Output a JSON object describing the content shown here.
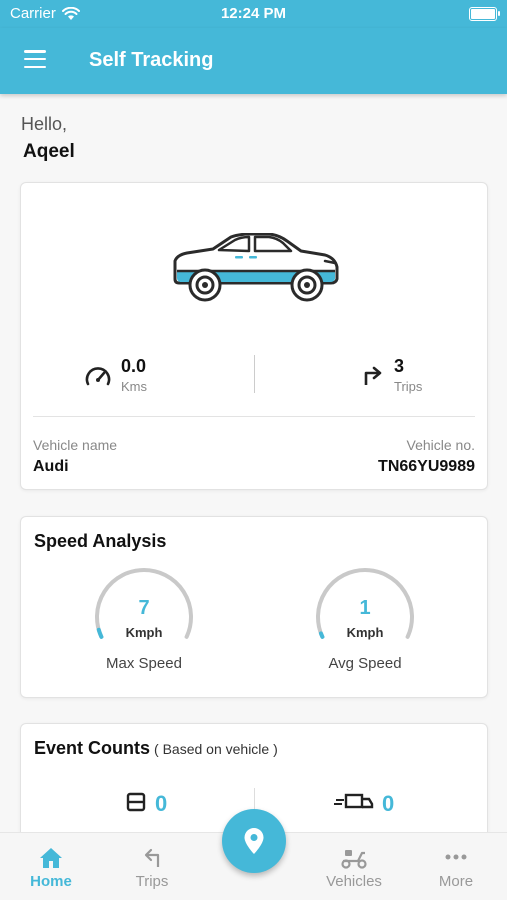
{
  "status_bar": {
    "carrier": "Carrier",
    "time": "12:24 PM"
  },
  "app_bar": {
    "title": "Self Tracking"
  },
  "greeting": {
    "hello": "Hello,",
    "name": "Aqeel"
  },
  "vehicle_card": {
    "distance_value": "0.0",
    "distance_unit": "Kms",
    "trips_value": "3",
    "trips_unit": "Trips",
    "vehicle_name_label": "Vehicle name",
    "vehicle_name": "Audi",
    "vehicle_no_label": "Vehicle no.",
    "vehicle_no": "TN66YU9989"
  },
  "speed_analysis": {
    "title": "Speed Analysis",
    "max": {
      "value": "7",
      "unit": "Kmph",
      "label": "Max Speed",
      "fraction": 0.04
    },
    "avg": {
      "value": "1",
      "unit": "Kmph",
      "label": "Avg Speed",
      "fraction": 0.02
    }
  },
  "event_counts": {
    "title": "Event Counts",
    "subtitle": "( Based on vehicle )",
    "left_value": "0",
    "right_value": "0"
  },
  "tabs": [
    {
      "label": "Home",
      "icon": "home-icon",
      "active": true
    },
    {
      "label": "Trips",
      "icon": "turn-left-arrow-icon",
      "active": false
    },
    {
      "label": "Vehicles",
      "icon": "scooter-icon",
      "active": false
    },
    {
      "label": "More",
      "icon": "more-dots-icon",
      "active": false
    }
  ],
  "fab": {
    "icon": "location-pin-icon"
  },
  "colors": {
    "accent": "#45b8d8",
    "background": "#f7f7f7",
    "card": "#ffffff"
  }
}
